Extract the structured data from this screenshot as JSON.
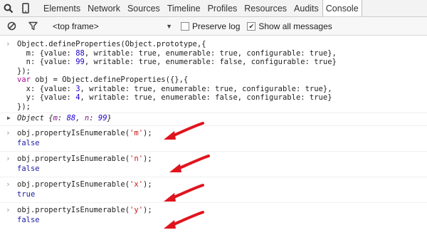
{
  "tabs": [
    "Elements",
    "Network",
    "Sources",
    "Timeline",
    "Profiles",
    "Resources",
    "Audits",
    "Console"
  ],
  "filterbar": {
    "frame": "<top frame>",
    "preserve_log": "Preserve log",
    "show_all": "Show all messages"
  },
  "code": {
    "l1": "Object.defineProperties(Object.prototype,{",
    "l2a": "  m: {value: ",
    "l2n": "88",
    "l2b": ", writable: true, enumerable: true, configurable: true},",
    "l3a": "  n: {value: ",
    "l3n": "99",
    "l3b": ", writable: true, enumerable: false, configurable: true}",
    "l4": "});",
    "l5kw": "var",
    "l5": " obj = Object.defineProperties({},{",
    "l6a": "  x: {value: ",
    "l6n": "3",
    "l6b": ", writable: true, enumerable: true, configurable: true},",
    "l7a": "  y: {value: ",
    "l7n": "4",
    "l7b": ", writable: true, enumerable: false, configurable: true}",
    "l8": "});"
  },
  "object_result": {
    "name": "Object ",
    "open": "{",
    "k1": "m",
    "sep1": ": ",
    "v1": "88",
    "comma": ", ",
    "k2": "n",
    "sep2": ": ",
    "v2": "99",
    "close": "}"
  },
  "checks": [
    {
      "pre": "obj.propertyIsEnumerable(",
      "arg": "'m'",
      "post": ");",
      "result": "false"
    },
    {
      "pre": "obj.propertyIsEnumerable(",
      "arg": "'n'",
      "post": ");",
      "result": "false"
    },
    {
      "pre": "obj.propertyIsEnumerable(",
      "arg": "'x'",
      "post": ");",
      "result": "true"
    },
    {
      "pre": "obj.propertyIsEnumerable(",
      "arg": "'y'",
      "post": ");",
      "result": "false"
    }
  ],
  "prompt_glyph": "›",
  "result_glyph": "▶",
  "colors": {
    "arrow": "#e0141e",
    "keyword": "#aa0d91",
    "number": "#1c00cf",
    "string": "#c41a16",
    "output": "#1a1aa6"
  }
}
